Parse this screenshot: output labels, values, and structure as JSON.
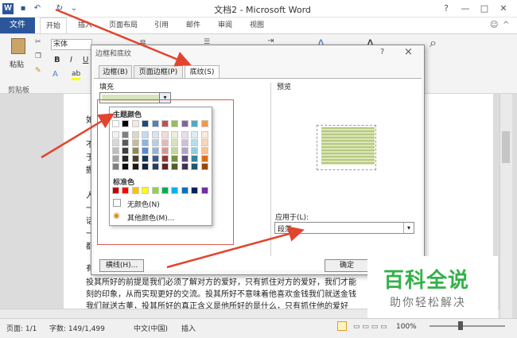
{
  "window": {
    "title": "文档2 - Microsoft Word",
    "app_icon": "W"
  },
  "ribbon": {
    "tabs": [
      "文件",
      "开始",
      "插入",
      "页面布局",
      "引用",
      "邮件",
      "审阅",
      "视图"
    ],
    "paste_label": "粘贴",
    "clipboard_label": "剪贴板",
    "font_name": "宋体",
    "font_size_fragment": "号",
    "bold": "B",
    "italic": "I",
    "underline": "U"
  },
  "dialog": {
    "title": "边框和底纹",
    "help": "?",
    "close": "×",
    "tabs": [
      "边框(B)",
      "页面边框(P)",
      "底纹(S)"
    ],
    "fill_label": "填充",
    "preview_label": "预览",
    "apply_label": "应用于(L):",
    "apply_value": "段落",
    "horizontal_line_button": "横线(H)...",
    "ok_button": "确定",
    "fill_color": "#d7e4bd"
  },
  "palette": {
    "theme_label": "主题颜色",
    "standard_label": "标准色",
    "no_color": "无颜色(N)",
    "more_colors": "其他颜色(M)...",
    "theme_top": [
      "#ffffff",
      "#000000",
      "#eeece1",
      "#1f497d",
      "#4f81bd",
      "#c0504d",
      "#9bbb59",
      "#8064a2",
      "#4bacc6",
      "#f79646"
    ],
    "theme_shades": [
      [
        "#f2f2f2",
        "#7f7f7f",
        "#ddd9c3",
        "#c6d9f0",
        "#dbe5f1",
        "#f2dcdb",
        "#ebf1dd",
        "#e5e0ec",
        "#dbeef3",
        "#fdeada"
      ],
      [
        "#d8d8d8",
        "#595959",
        "#c4bd97",
        "#8db3e2",
        "#b8cce4",
        "#e5b9b7",
        "#d7e3bc",
        "#ccc1d9",
        "#b7dde8",
        "#fbd5b5"
      ],
      [
        "#bfbfbf",
        "#3f3f3f",
        "#938953",
        "#548dd4",
        "#95b3d7",
        "#d99694",
        "#c3d69b",
        "#b2a2c7",
        "#92cddc",
        "#fac08f"
      ],
      [
        "#a5a5a5",
        "#262626",
        "#494429",
        "#17365d",
        "#366092",
        "#953734",
        "#76923c",
        "#5f497a",
        "#31859b",
        "#e36c09"
      ],
      [
        "#7f7f7f",
        "#0c0c0c",
        "#1d1b10",
        "#0f243e",
        "#244061",
        "#632423",
        "#4f6128",
        "#3f3151",
        "#205867",
        "#974806"
      ]
    ],
    "standard": [
      "#c00000",
      "#ff0000",
      "#ffc000",
      "#ffff00",
      "#92d050",
      "#00b050",
      "#00b0f0",
      "#0070c0",
      "#002060",
      "#7030a0"
    ]
  },
  "document": {
    "lines": [
      "如",
      "不",
      "于",
      "握",
      "人",
      "一",
      "话",
      "一",
      "都",
      "有"
    ],
    "paragraph": [
      "投其所好的前提是我们必须了解对方的爱好，只有抓住对方的爱好，我们才能",
      "刻的印象，从而实现更好的交流。投其所好不意味着他喜欢金钱我们就送金钱",
      "我们就送古董，投其所好的真正含义是他所好的是什么，只有抓住他的爱好"
    ]
  },
  "status": {
    "page": "页面: 1/1",
    "words": "字数: 149/1,499",
    "language": "中文(中国)",
    "mode": "插入",
    "zoom": "100%"
  },
  "watermark": {
    "title": "百科全说",
    "subtitle": "助你轻松解决"
  }
}
